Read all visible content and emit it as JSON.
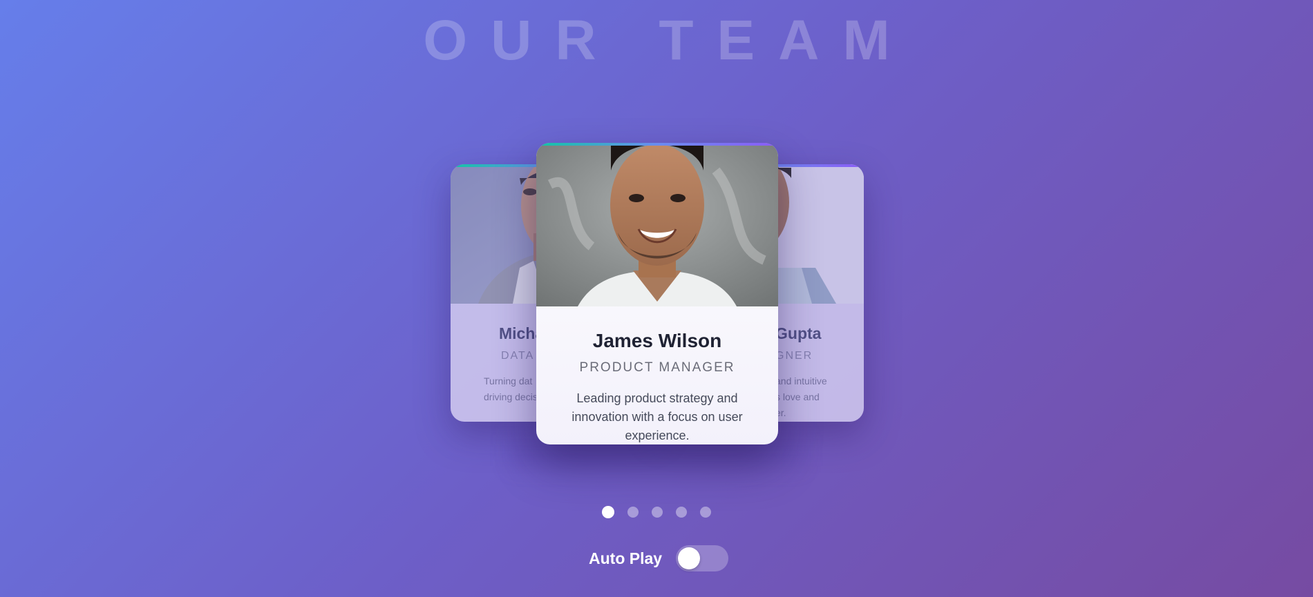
{
  "header": {
    "title": "OUR TEAM"
  },
  "carousel": {
    "active_index": 0,
    "cards": {
      "left": {
        "name": "Micha",
        "role": "DATA",
        "desc_line1": "Turning dat",
        "desc_line2": "driving decis"
      },
      "center": {
        "name": "James Wilson",
        "role": "PRODUCT MANAGER",
        "description": "Leading product strategy and innovation with a focus on user experience."
      },
      "right": {
        "name": "Gupta",
        "role": "GNER",
        "desc_line1": "and intuitive",
        "desc_line2": "s love and",
        "desc_line3": "er."
      }
    },
    "dots_count": 5
  },
  "controls": {
    "autoplay_label": "Auto Play",
    "autoplay_on": false
  },
  "colors": {
    "bg_start": "#667eea",
    "bg_end": "#764ba2",
    "accent_bar": "#11c5a5"
  }
}
